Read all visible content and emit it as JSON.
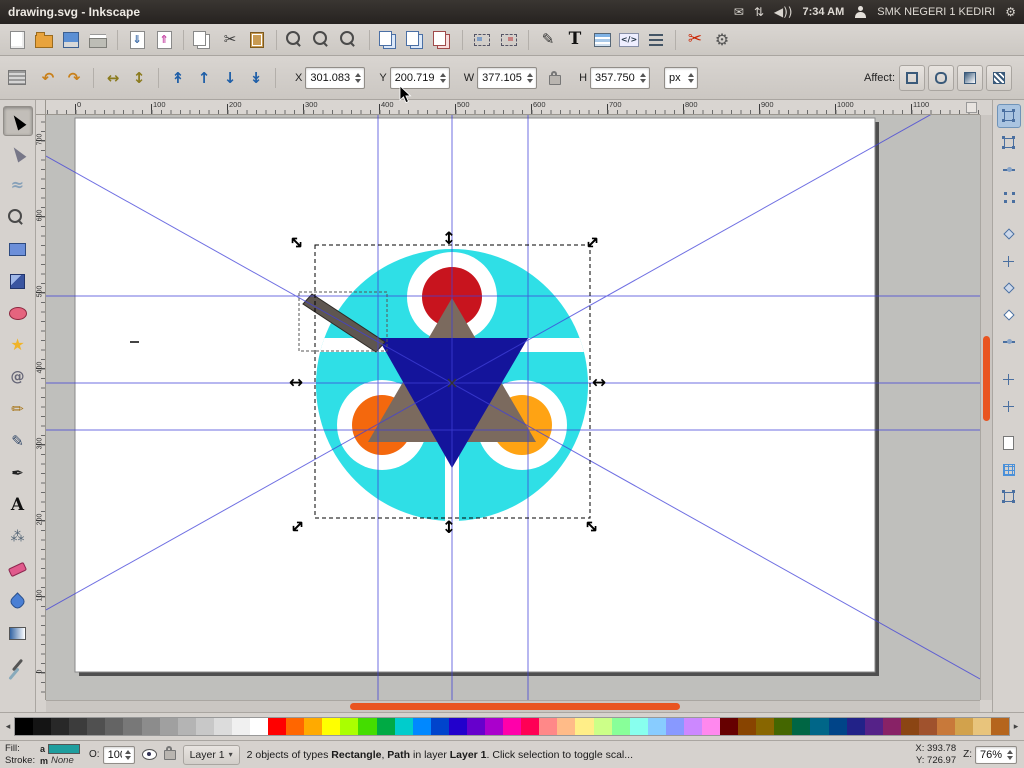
{
  "colors": {
    "accent_orange": "#E95420",
    "guide_blue": "#4040D9",
    "art_cyan": "#2FDFE6",
    "art_red": "#C8141E",
    "art_orange": "#F4680D",
    "art_amber": "#FFA313",
    "art_navy": "#14149B",
    "art_brown": "#7B6A5E",
    "art_pencil": "#5E5650",
    "fill_swatch": "#1E9E9E",
    "desk": "#BFBFBC",
    "chrome": "#D6D2CE"
  },
  "panel": {
    "title": "drawing.svg - Inkscape",
    "time": "7:34 AM",
    "user": "SMK NEGERI 1 KEDIRI",
    "icons": {
      "mail": "✉",
      "updown": "⇅",
      "volume": "◀))",
      "gear": "⚙"
    }
  },
  "icons": {
    "chevron_down": "▾",
    "palette_left": "◂",
    "palette_right": "▸"
  },
  "command_toolbar": {
    "items": [
      {
        "name": "new-document",
        "kind": "k-page"
      },
      {
        "name": "open-document",
        "kind": "k-folder"
      },
      {
        "name": "save-document",
        "kind": "k-save"
      },
      {
        "name": "print-document",
        "kind": "k-print"
      },
      {
        "sep": true
      },
      {
        "name": "import-bitmap",
        "kind": "k-io",
        "glyph": "⇓"
      },
      {
        "name": "export-bitmap",
        "kind": "k-io k-exp",
        "glyph": "⇑"
      },
      {
        "sep": true
      },
      {
        "name": "copy",
        "kind": "k-copy"
      },
      {
        "name": "cut",
        "kind": "k-glyph",
        "glyph": "✂"
      },
      {
        "name": "paste",
        "kind": "k-paste"
      },
      {
        "sep": true
      },
      {
        "name": "zoom-selection",
        "kind": "k-mag"
      },
      {
        "name": "zoom-drawing",
        "kind": "k-mag"
      },
      {
        "name": "zoom-page",
        "kind": "k-mag"
      },
      {
        "sep": true
      },
      {
        "name": "duplicate",
        "kind": "k-copy k-blue"
      },
      {
        "name": "create-clone",
        "kind": "k-copy k-blue"
      },
      {
        "name": "unlink-clone",
        "kind": "k-copy k-red"
      },
      {
        "sep": true
      },
      {
        "name": "group-objects",
        "kind": "k-group"
      },
      {
        "name": "ungroup-objects",
        "kind": "k-group k-ungroup"
      },
      {
        "sep": true
      },
      {
        "name": "fill-stroke-dialog",
        "kind": "k-glyph k-dark",
        "glyph": "✎"
      },
      {
        "name": "text-dialog",
        "kind": "k-glyph k-textT",
        "glyph": "T"
      },
      {
        "name": "layers-dialog",
        "kind": "k-layers"
      },
      {
        "name": "xml-editor",
        "kind": "k-glyph k-xml",
        "glyph": "</>"
      },
      {
        "name": "align-distribute-dialog",
        "kind": "k-align"
      },
      {
        "sep": true
      },
      {
        "name": "scissors",
        "kind": "k-glyph k-redcut",
        "glyph": "✂"
      },
      {
        "name": "preferences",
        "kind": "k-glyph k-gear",
        "glyph": "⚙"
      }
    ]
  },
  "tool_controls": {
    "buttons_left": [
      {
        "name": "rotate-ccw",
        "glyph": "↶",
        "cls": "c-rot"
      },
      {
        "name": "rotate-cw",
        "glyph": "↷",
        "cls": "c-rot"
      },
      {
        "sep": true
      },
      {
        "name": "flip-horizontal",
        "glyph": "↔",
        "cls": "c-flip"
      },
      {
        "name": "flip-vertical",
        "glyph": "↕",
        "cls": "c-flip"
      },
      {
        "sep": true
      },
      {
        "name": "raise-to-top",
        "glyph": "↟",
        "cls": "c-z"
      },
      {
        "name": "raise",
        "glyph": "↑",
        "cls": "c-z"
      },
      {
        "name": "lower",
        "glyph": "↓",
        "cls": "c-z"
      },
      {
        "name": "lower-to-bottom",
        "glyph": "↡",
        "cls": "c-z"
      },
      {
        "sep": true
      }
    ],
    "x_label": "X",
    "x_value": "301.083",
    "y_label": "Y",
    "y_value": "200.719",
    "w_label": "W",
    "w_value": "377.105",
    "h_label": "H",
    "h_value": "357.750",
    "unit": "px",
    "affect_label": "Affect:",
    "affect_buttons": [
      {
        "name": "affect-stroke",
        "kind": "a1"
      },
      {
        "name": "affect-corners",
        "kind": "a2"
      },
      {
        "name": "affect-gradients",
        "kind": "a3"
      },
      {
        "name": "affect-patterns",
        "kind": "a4"
      }
    ]
  },
  "rulers": {
    "horizontal": [
      "0",
      "100",
      "200",
      "300",
      "400",
      "500",
      "600",
      "700",
      "800",
      "900",
      "1000",
      "1100"
    ],
    "vertical": [
      "700",
      "600",
      "500",
      "400",
      "300",
      "200",
      "100",
      "0"
    ]
  },
  "toolbox": {
    "tools": [
      {
        "name": "tool-selector",
        "kind": "t-select",
        "active": true
      },
      {
        "name": "tool-node-editor",
        "kind": "t-node"
      },
      {
        "name": "tool-tweak",
        "kind": "t-tweak",
        "glyph": "≈"
      },
      {
        "name": "tool-zoom",
        "kind": "k-mag"
      },
      {
        "name": "tool-rectangle",
        "kind": "t-rect"
      },
      {
        "name": "tool-3dbox",
        "kind": "t-box3d"
      },
      {
        "name": "tool-ellipse",
        "kind": "t-ellipse"
      },
      {
        "name": "tool-star",
        "kind": "t-star",
        "glyph": "★"
      },
      {
        "name": "tool-spiral",
        "kind": "t-spiral",
        "glyph": "@"
      },
      {
        "name": "tool-pencil",
        "kind": "t-pencil",
        "glyph": "✏"
      },
      {
        "name": "tool-bezier",
        "kind": "t-pen",
        "glyph": "✎"
      },
      {
        "name": "tool-calligraphy",
        "kind": "t-callig",
        "glyph": "✒"
      },
      {
        "name": "tool-text",
        "kind": "t-text",
        "glyph": "A"
      },
      {
        "name": "tool-spray",
        "kind": "t-spray",
        "glyph": "⁂"
      },
      {
        "name": "tool-eraser",
        "kind": "t-eraser"
      },
      {
        "name": "tool-paint-bucket",
        "kind": "t-bucket"
      },
      {
        "name": "tool-gradient",
        "kind": "t-grad"
      },
      {
        "name": "tool-dropper",
        "kind": "t-dropper"
      }
    ]
  },
  "snapbar": {
    "buttons": [
      {
        "name": "snap-enable",
        "kind": "s-box",
        "active": true
      },
      {
        "name": "snap-bbox",
        "kind": "s-box"
      },
      {
        "name": "snap-bbox-edges",
        "kind": "s-mid"
      },
      {
        "name": "snap-bbox-corners",
        "kind": "s-dots"
      },
      {
        "sep": true
      },
      {
        "name": "snap-nodes",
        "kind": "s-dia"
      },
      {
        "name": "snap-path-intersections",
        "kind": "s-cross"
      },
      {
        "name": "snap-cusp-nodes",
        "kind": "s-dia"
      },
      {
        "name": "snap-smooth-nodes",
        "kind": "s-dia s-lite"
      },
      {
        "name": "snap-midpoints",
        "kind": "s-mid"
      },
      {
        "sep": true
      },
      {
        "name": "snap-object-centers",
        "kind": "s-cross"
      },
      {
        "name": "snap-rotation-centers",
        "kind": "s-cross"
      },
      {
        "sep": true
      },
      {
        "name": "snap-page-border",
        "kind": "s-page"
      },
      {
        "name": "snap-grid",
        "kind": "s-grid"
      },
      {
        "name": "snap-guides",
        "kind": "s-box"
      }
    ]
  },
  "palette": {
    "colors": [
      "#000000",
      "#141414",
      "#282828",
      "#3C3C3C",
      "#505050",
      "#646464",
      "#787878",
      "#8C8C8C",
      "#A0A0A0",
      "#B4B4B4",
      "#C8C8C8",
      "#DCDCDC",
      "#F0F0F0",
      "#FFFFFF",
      "#FF0000",
      "#FF6600",
      "#FFAA00",
      "#FFFF00",
      "#AAFF00",
      "#44DD00",
      "#00AA44",
      "#00CCCC",
      "#0088FF",
      "#0044CC",
      "#2200CC",
      "#6600CC",
      "#AA00CC",
      "#FF00AA",
      "#FF0055",
      "#FF8888",
      "#FFBB88",
      "#FFEE88",
      "#CCFF88",
      "#88FF99",
      "#88FFEE",
      "#88CCFF",
      "#8899FF",
      "#CC88FF",
      "#FF88EE",
      "#660000",
      "#884400",
      "#886600",
      "#446600",
      "#006644",
      "#006688",
      "#004488",
      "#222288",
      "#552288",
      "#882266",
      "#8B4513",
      "#A0522D",
      "#C8793A",
      "#D2A24C",
      "#E8C47C",
      "#B5651D"
    ]
  },
  "statusbar": {
    "fill_label": "Fill:",
    "fill_flag": "a",
    "stroke_label": "Stroke:",
    "stroke_flag": "m",
    "stroke_value": "None",
    "opacity_label": "O:",
    "opacity_value": "100",
    "layer_name": "Layer 1",
    "message": {
      "p1": "2 objects of types ",
      "b1": "Rectangle",
      "p2": ", ",
      "b2": "Path",
      "p3": " in layer ",
      "b3": "Layer 1",
      "p4": ". Click selection to toggle scal..."
    },
    "x_label": "X:",
    "x_value": "393.78",
    "y_label": "Y:",
    "y_value": "726.97",
    "zoom_label": "Z:",
    "zoom_value": "76%"
  }
}
